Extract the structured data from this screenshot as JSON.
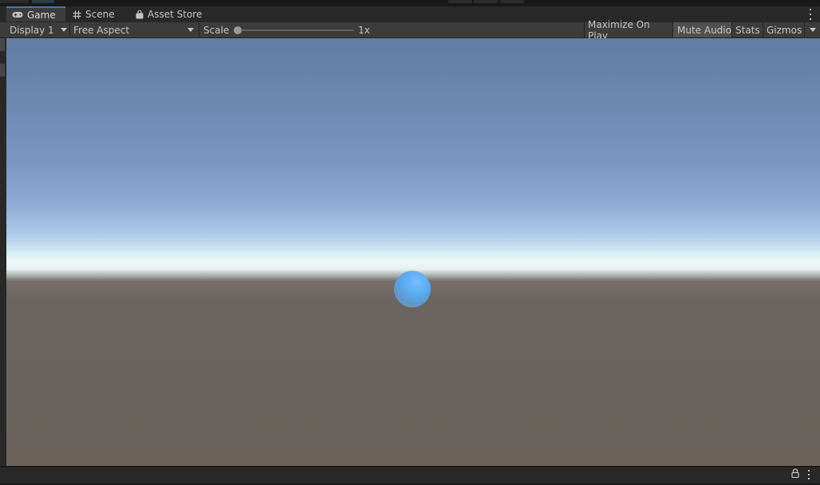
{
  "tabs": [
    {
      "label": "Game",
      "icon": "gamepad-icon",
      "active": true
    },
    {
      "label": "Scene",
      "icon": "grid-icon",
      "active": false
    },
    {
      "label": "Asset Store",
      "icon": "shopping-bag-icon",
      "active": false
    }
  ],
  "toolbar": {
    "display": "Display 1",
    "aspect": "Free Aspect",
    "scale_label": "Scale",
    "scale_value": "1x",
    "scale_level": 0.0,
    "maximize_on_play": "Maximize On Play",
    "mute_audio": "Mute Audio",
    "stats": "Stats",
    "gizmos": "Gizmos"
  },
  "colors": {
    "accent": "#3a79bb",
    "sky_top": "#627da3",
    "horizon": "#eef9f5",
    "ground": "#6b635c",
    "sphere": "#5aaaf0"
  }
}
